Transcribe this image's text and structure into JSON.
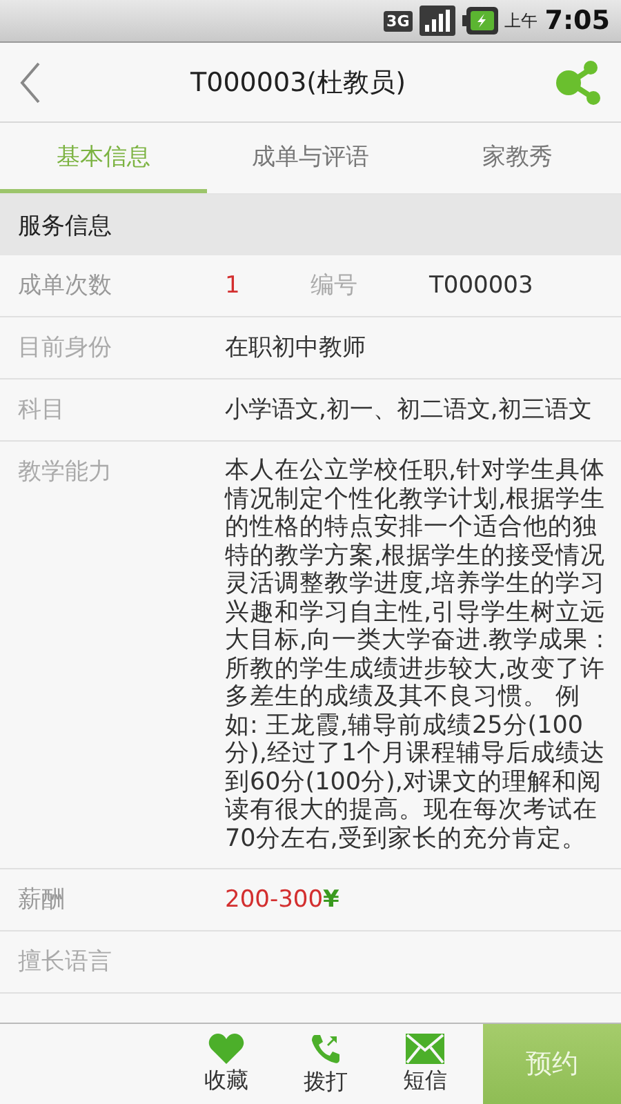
{
  "status_bar": {
    "network": "3G",
    "period": "上午",
    "time": "7:05"
  },
  "header": {
    "title": "T000003(杜教员)"
  },
  "tabs": [
    {
      "label": "基本信息",
      "selected": true
    },
    {
      "label": "成单与评语",
      "selected": false
    },
    {
      "label": "家教秀",
      "selected": false
    }
  ],
  "section": {
    "title": "服务信息"
  },
  "rows": [
    {
      "label": "成单次数",
      "value": "1",
      "accent": true,
      "label_2": "编号",
      "value_2": "T000003"
    },
    {
      "label": "目前身份",
      "value": "在职初中教师",
      "accent": false
    },
    {
      "label": "科目",
      "value": "小学语文,初一、初二语文,初三语文",
      "accent": false
    },
    {
      "label": "教学能力",
      "value": "本人在公立学校任职,针对学生具体情况制定个性化教学计划,根据学生的性格的特点安排一个适合他的独特的教学方案,根据学生的接受情况灵活调整教学进度,培养学生的学习兴趣和学习自主性,引导学生树立远大目标,向一类大学奋进.教学成果 : 所教的学生成绩进步较大,改变了许多差生的成绩及其不良习惯。 例如: 王龙霞,辅导前成绩25分(100分),经过了1个月课程辅导后成绩达到60分(100分),对课文的理解和阅读有很大的提高。现在每次考试在70分左右,受到家长的充分肯定。",
      "accent": false
    },
    {
      "label": "薪酬",
      "value": "200-300",
      "accent": true,
      "currency": "¥"
    },
    {
      "label": "擅长语言",
      "accent": false
    }
  ],
  "actions": [
    {
      "kind": "heart",
      "label": "收藏"
    },
    {
      "kind": "phone",
      "label": "拨打"
    },
    {
      "kind": "mail",
      "label": "短信"
    }
  ],
  "primary_button": {
    "label": "预约"
  }
}
